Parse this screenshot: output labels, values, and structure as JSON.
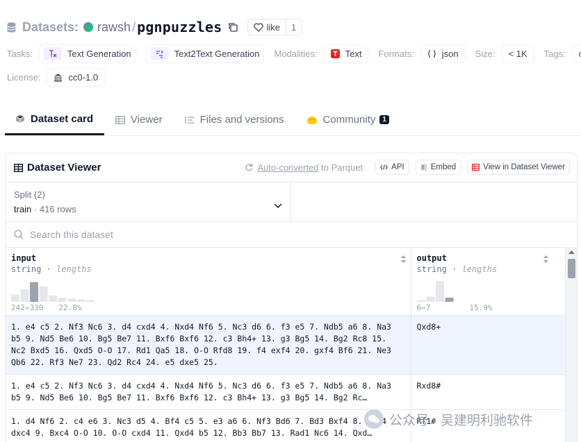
{
  "header": {
    "section_label": "Datasets:",
    "owner": "rawsh",
    "separator": "/",
    "repo_name": "pgnpuzzles",
    "like_label": "like",
    "like_count": "1"
  },
  "meta": {
    "tasks_label": "Tasks:",
    "tasks": [
      "Text Generation",
      "Text2Text Generation"
    ],
    "modalities_label": "Modalities:",
    "modality": "Text",
    "formats_label": "Formats:",
    "format": "json",
    "size_label": "Size:",
    "size": "< 1K",
    "tags_label": "Tags:",
    "tag_partial": "che",
    "license_label": "License:",
    "license": "cc0-1.0"
  },
  "tabs": [
    {
      "label": "Dataset card",
      "active": true
    },
    {
      "label": "Viewer"
    },
    {
      "label": "Files and versions"
    },
    {
      "label": "Community",
      "badge": "1"
    }
  ],
  "viewer": {
    "title": "Dataset Viewer",
    "auto_converted": "Auto-converted",
    "to_parquet": "to Parquet",
    "api_label": "API",
    "embed_label": "Embed",
    "view_label": "View in Dataset Viewer",
    "split_label": "Split (2)",
    "split_name": "train",
    "split_sep": "·",
    "split_rows": "416 rows",
    "search_placeholder": "Search this dataset",
    "columns": [
      {
        "name": "input",
        "type": "string",
        "type_sep": "·",
        "stat": "lengths",
        "range": "242⇿330",
        "pct": "22.8%",
        "hist": [
          0.35,
          0.6,
          0.95,
          0.75,
          0.3,
          0.2,
          0.15,
          0.12,
          0.08
        ],
        "highlight": 2
      },
      {
        "name": "output",
        "type": "string",
        "type_sep": "·",
        "stat": "lengths",
        "range": "6⇿7",
        "pct": "15.9%",
        "hist": [
          0.08,
          0.25,
          1.0,
          0.2
        ],
        "highlight": 3
      }
    ],
    "rows": [
      {
        "input": "1. e4 c5 2. Nf3 Nc6 3. d4 cxd4 4. Nxd4 Nf6 5. Nc3 d6 6. f3 e5 7. Ndb5 a6 8. Na3 b5 9. Nd5 Be6 10. Bg5 Be7 11. Bxf6 Bxf6 12. c3 Bh4+ 13. g3 Bg5 14. Bg2 Rc8 15. Nc2 Bxd5 16. Qxd5 O-O 17. Rd1 Qa5 18. O-O Rfd8 19. f4 exf4 20. gxf4 Bf6 21. Ne3 Qb6 22. Rf3 Ne7 23. Qd2 Rc4 24. e5 dxe5 25.",
        "output": "Qxd8+"
      },
      {
        "input": "1. e4 c5 2. Nf3 Nc6 3. d4 cxd4 4. Nxd4 Nf6 5. Nc3 d6 6. f3 e5 7. Ndb5 a6 8. Na3 b5 9. Nd5 Be6 10. Bg5 Be7 11. Bxf6 Bxf6 12. c3 Bh4+ 13. g3 Bg5 14. Bg2 Rc…",
        "output": "Rxd8#"
      },
      {
        "input": "1. d4 Nf6 2. c4 e6 3. Nc3 d5 4. Bf4 c5 5. e3 a6 6. Nf3 Bd6 7. Bd3 Bxf4 8. exf4 dxc4 9. Bxc4 O-O 10. O-O cxd4 11. Qxd4 b5 12. Bb3 Bb7 13. Rad1 Nc6 14. Qxd…",
        "output": "Rf1#"
      }
    ]
  },
  "watermark": "公众号 · 吴建明利驰软件",
  "colors": {
    "accent": "#111827",
    "highlight_row": "#eff4ff",
    "hist_bar": "#e5e7eb",
    "hist_highlight": "#9ca3af"
  }
}
